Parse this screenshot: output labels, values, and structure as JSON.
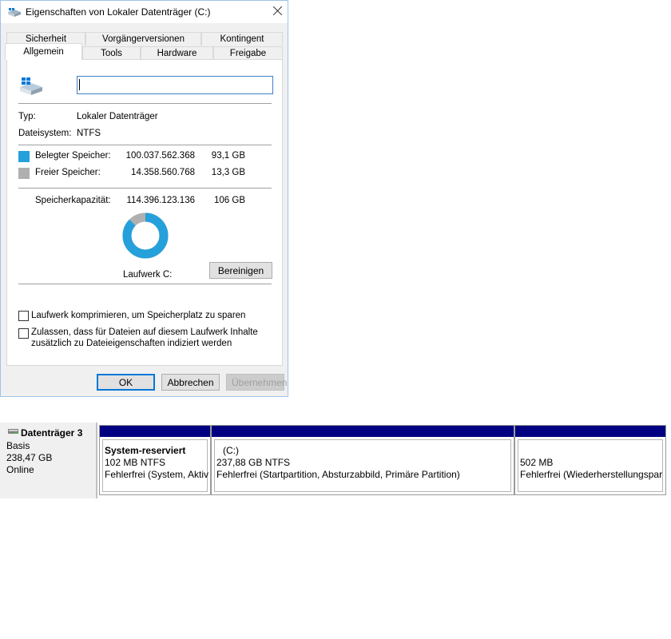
{
  "dialog": {
    "title": "Eigenschaften von Lokaler Datenträger (C:)",
    "tabs_row1": [
      "Sicherheit",
      "Vorgängerversionen",
      "Kontingent"
    ],
    "tabs_row2": [
      "Allgemein",
      "Tools",
      "Hardware",
      "Freigabe"
    ],
    "active_tab": "Allgemein",
    "name_value": "",
    "type_label": "Typ:",
    "type_value": "Lokaler Datenträger",
    "fs_label": "Dateisystem:",
    "fs_value": "NTFS",
    "used_label": "Belegter Speicher:",
    "used_bytes": "100.037.562.368",
    "used_gb": "93,1 GB",
    "free_label": "Freier Speicher:",
    "free_bytes": "14.358.560.768",
    "free_gb": "13,3 GB",
    "capacity_label": "Speicherkapazität:",
    "capacity_bytes": "114.396.123.136",
    "capacity_gb": "106 GB",
    "used_fraction": 0.8745,
    "drive_label": "Laufwerk C:",
    "cleanup_button": "Bereinigen",
    "compress_label": "Laufwerk komprimieren, um Speicherplatz zu sparen",
    "index_label_1": "Zulassen, dass für Dateien auf diesem Laufwerk Inhalte",
    "index_label_2": "zusätzlich zu Dateieigenschaften indiziert werden",
    "ok_button": "OK",
    "cancel_button": "Abbrechen",
    "apply_button": "Übernehmen",
    "colors": {
      "used": "#26a0da",
      "free": "#b0b0b0",
      "accent": "#0078d7"
    }
  },
  "disk": {
    "name": "Datenträger 3",
    "type": "Basis",
    "size": "238,47 GB",
    "status": "Online",
    "partitions": [
      {
        "name": "System-reserviert",
        "size": "102 MB NTFS",
        "status": "Fehlerfrei (System, Aktiv"
      },
      {
        "name": "(C:)",
        "size": "237,88 GB NTFS",
        "status": "Fehlerfrei (Startpartition, Absturzabbild, Primäre Partition)"
      },
      {
        "name": "",
        "size": "502 MB",
        "status": "Fehlerfrei (Wiederherstellungspar"
      }
    ],
    "colors": {
      "partition_bar": "#000080"
    }
  }
}
